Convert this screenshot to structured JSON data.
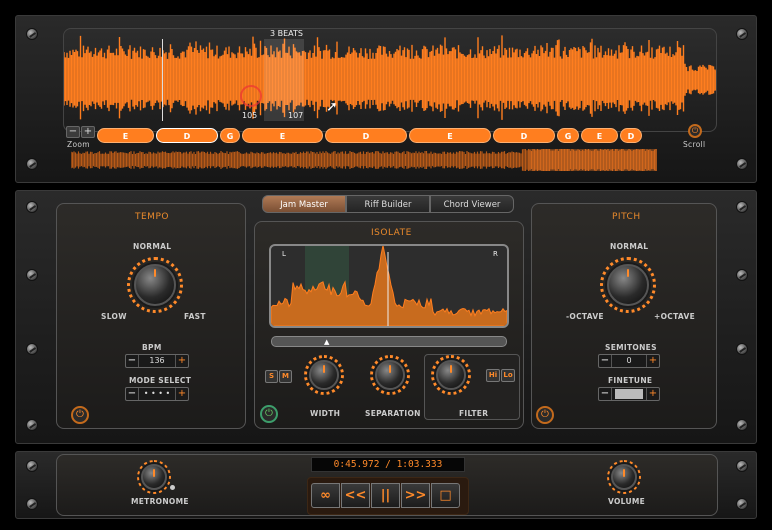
{
  "waveform": {
    "beats_label": "3 BEATS",
    "marker_start": "105",
    "marker_end": "107",
    "zoom_label": "Zoom",
    "scroll_label": "Scroll",
    "chords": [
      "E",
      "D",
      "G",
      "E",
      "D",
      "E",
      "D",
      "G",
      "E",
      "D"
    ]
  },
  "tabs": [
    "Jam Master",
    "Riff Builder",
    "Chord Viewer"
  ],
  "active_tab": 0,
  "tempo": {
    "title": "TEMPO",
    "normal": "NORMAL",
    "slow": "SLOW",
    "fast": "FAST",
    "bpm_label": "BPM",
    "bpm_value": "136",
    "mode_label": "MODE SELECT",
    "mode_value": "• • • •"
  },
  "isolate": {
    "title": "ISOLATE",
    "left": "L",
    "right": "R",
    "width_label": "WIDTH",
    "separation_label": "SEPARATION",
    "filter_label": "FILTER",
    "s": "S",
    "m": "M",
    "hi": "Hi",
    "lo": "Lo"
  },
  "pitch": {
    "title": "PITCH",
    "normal": "NORMAL",
    "minus": "-OCTAVE",
    "plus": "+OCTAVE",
    "semitones_label": "SEMITONES",
    "semitones_value": "0",
    "finetune_label": "FINETUNE"
  },
  "transport": {
    "time": "0:45.972 / 1:03.333",
    "metronome_label": "METRONOME",
    "volume_label": "VOLUME",
    "loop": "∞",
    "rewind": "<<",
    "pause": "||",
    "forward": ">>",
    "stop": "□"
  },
  "colors": {
    "accent": "#ff7e1f",
    "panel": "#1d1d1d"
  }
}
